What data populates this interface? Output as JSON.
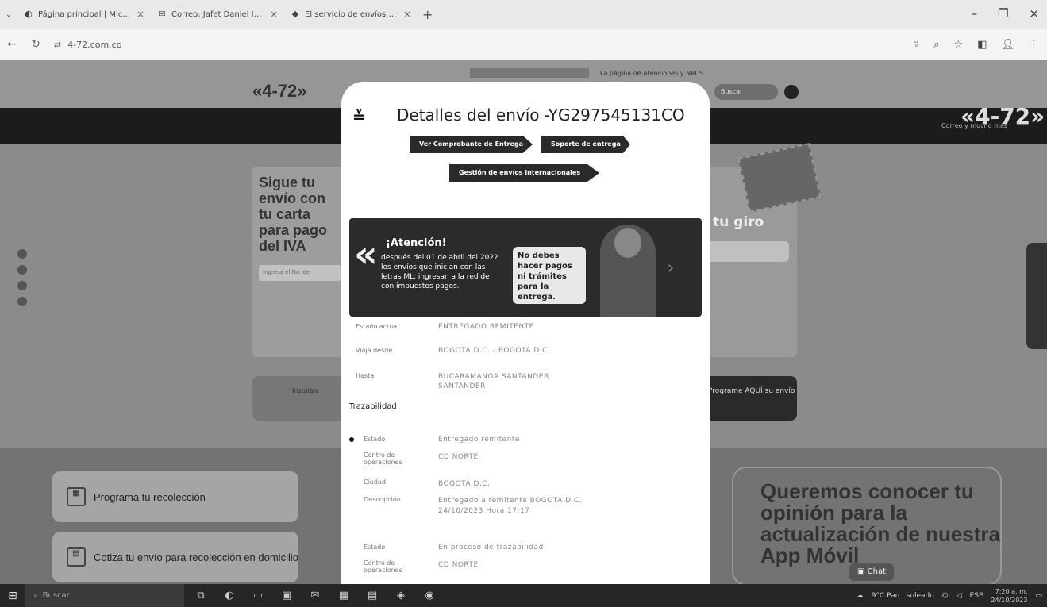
{
  "browser": {
    "tabs": [
      {
        "icon": "edge-icon",
        "title": "Página principal | Microsoft S"
      },
      {
        "icon": "outlook-icon",
        "title": "Correo: Jafet Daniel Iseda Dr"
      },
      {
        "icon": "472-icon",
        "title": "El servicio de envíos de Colo"
      }
    ],
    "url": "4-72.com.co"
  },
  "site": {
    "logo": "«4-72»",
    "right_logo": "«4-72»",
    "slogan": "Correo y mucho más",
    "top_link": "La página de Atenciones y NRCS",
    "search_placeholder": "Buscar",
    "sigue_card_title": "Sigue tu envío con tu carta para pago del IVA",
    "sigue_input": "Ingresa el No. de",
    "giro_title": "tu giro",
    "instala_text": "Instálala",
    "programe_text": "Programe AQUÍ su envío",
    "programa_label": "Programa tu recolección",
    "cotiza_label": "Cotiza tu envío para recolección en domicilio",
    "queremos_text": "Queremos conocer tu opinión para la actualización de nuestra App Móvil",
    "chat_label": "Chat"
  },
  "modal": {
    "title": "Detalles del envío -YG297545131CO",
    "btn_comprobante": "Ver Comprobante de Entrega",
    "btn_soporte": "Soporte de entrega",
    "btn_internacional": "Gestión de envíos internacionales",
    "banner": {
      "heading": "¡Atención!",
      "message": "después del 01 de abril del 2022 los envíos que inician con las letras ML, ingresan a la red de con impuestos pagos.",
      "box": "No debes hacer pagos ni trámites para la entrega."
    },
    "fields": [
      {
        "label": "Estado actual",
        "value": "ENTREGADO REMITENTE"
      },
      {
        "label": "Viaja desde",
        "value": "BOGOTA D.C. - BOGOTA D.C."
      },
      {
        "label": "Hasta",
        "value": "BUCARAMANGA SANTANDER SANTANDER"
      }
    ],
    "trazabilidad_label": "Trazabilidad",
    "traz": [
      {
        "label": "Estado",
        "value": "Entregado remitente"
      },
      {
        "label": "Centro de operaciones",
        "value": "CD NORTE"
      },
      {
        "label": "Ciudad",
        "value": "BOGOTA D.C."
      },
      {
        "label": "Descripción",
        "value": "Entregado a remitente BOGOTA D.C. 24/10/2023 Hora 17:17"
      },
      {
        "label": "Estado",
        "value": "En proceso de trazabilidad"
      },
      {
        "label": "Centro de operaciones",
        "value": "CD NORTE"
      }
    ]
  },
  "taskbar": {
    "search_placeholder": "Buscar",
    "weather": "9°C Parc. soleado",
    "lang": "ESP",
    "time": "7:20 a. m.",
    "date": "24/10/2023"
  }
}
